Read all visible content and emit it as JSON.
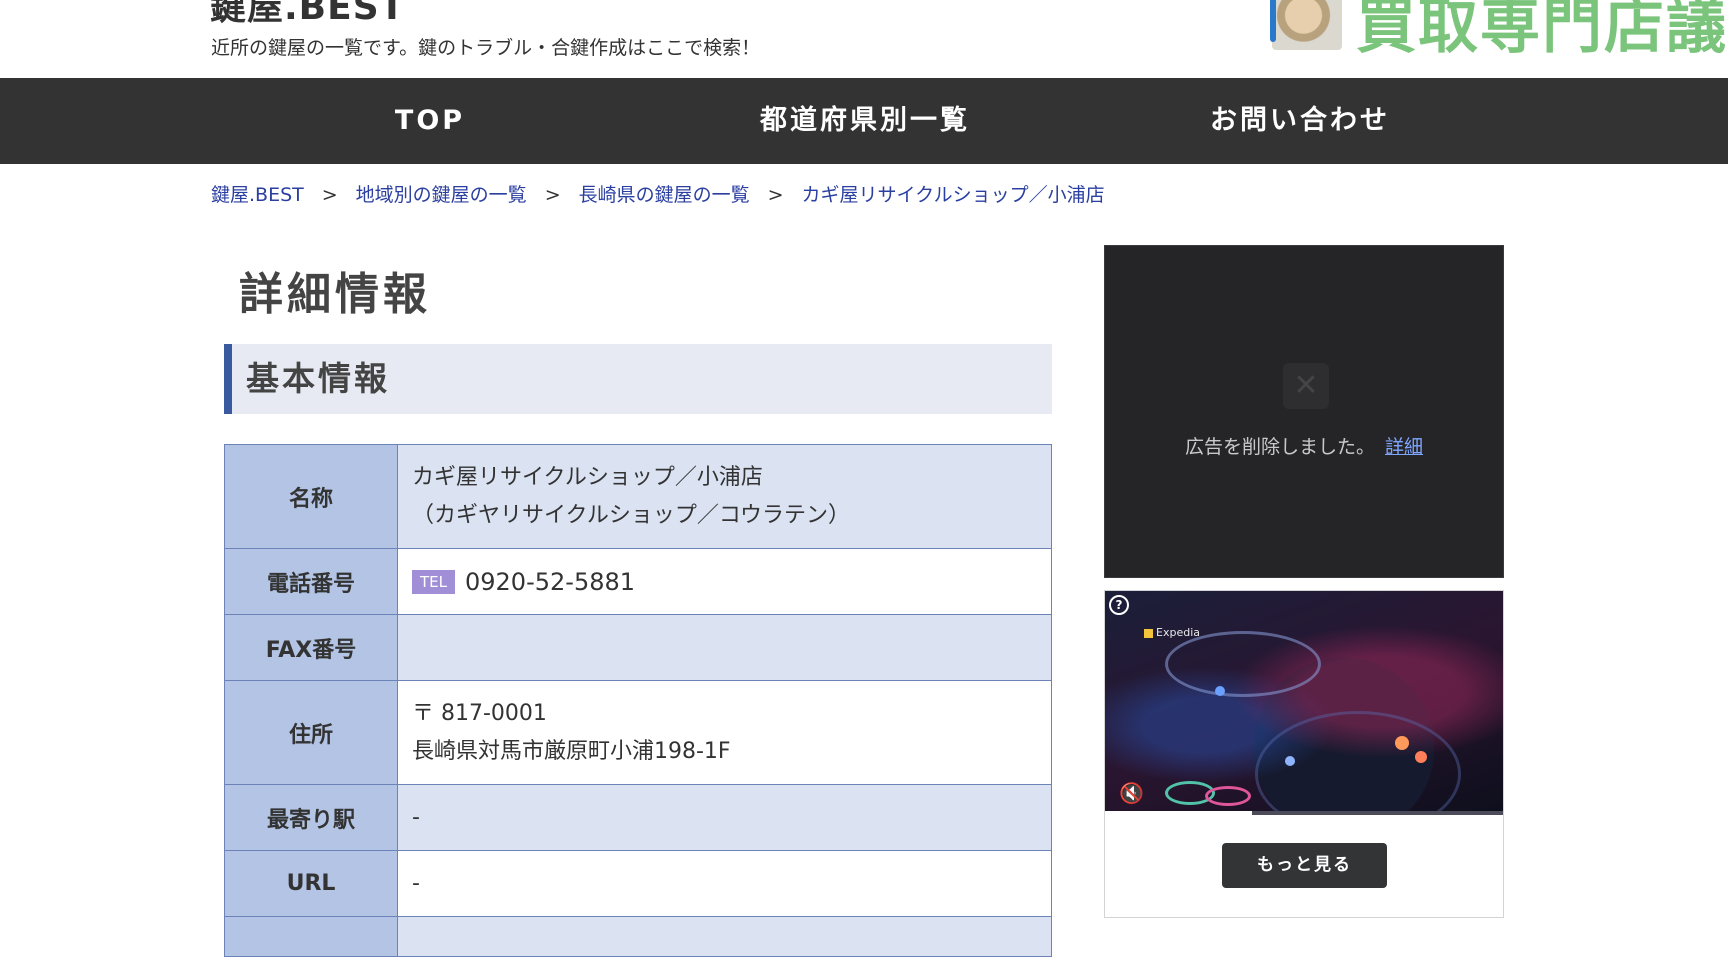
{
  "header": {
    "site_title": "鍵屋.BEST",
    "tagline": "近所の鍵屋の一覧です。鍵のトラブル・合鍵作成はここで検索！",
    "banner_text": "買取専門店議"
  },
  "nav": {
    "items": [
      {
        "label": "TOP"
      },
      {
        "label": "都道府県別一覧"
      },
      {
        "label": "お問い合わせ"
      }
    ]
  },
  "breadcrumb": {
    "separator": ">",
    "items": [
      {
        "label": "鍵屋.BEST"
      },
      {
        "label": "地域別の鍵屋の一覧"
      },
      {
        "label": "長崎県の鍵屋の一覧"
      },
      {
        "label": "カギ屋リサイクルショップ／小浦店"
      }
    ]
  },
  "main": {
    "page_title": "詳細情報",
    "section_title": "基本情報",
    "table": {
      "name": {
        "label": "名称",
        "value": "カギ屋リサイクルショップ／小浦店",
        "reading": "（カギヤリサイクルショップ／コウラテン）"
      },
      "phone": {
        "label": "電話番号",
        "badge": "TEL",
        "value": "0920-52-5881"
      },
      "fax": {
        "label": "FAX番号",
        "value": ""
      },
      "address": {
        "label": "住所",
        "postal": "〒 817-0001",
        "value": "長崎県対馬市厳原町小浦198-1F"
      },
      "station": {
        "label": "最寄り駅",
        "value": "-"
      },
      "url": {
        "label": "URL",
        "value": "-"
      }
    }
  },
  "ads": {
    "removed_message": "広告を削除しました。",
    "details_link": "詳細",
    "video_brand": "Expedia",
    "more_button": "もっと見る",
    "video_progress": 0.37
  }
}
